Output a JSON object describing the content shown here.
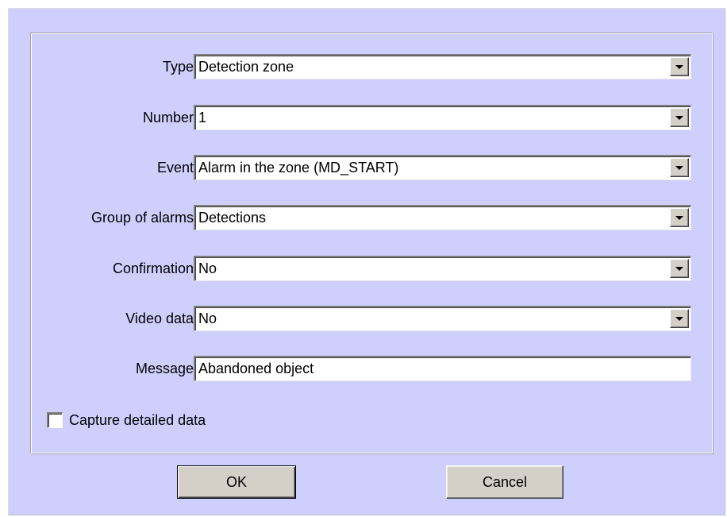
{
  "form": {
    "fields": [
      {
        "label": "Type",
        "value": "Detection zone",
        "kind": "dropdown"
      },
      {
        "label": "Number",
        "value": "1",
        "kind": "dropdown"
      },
      {
        "label": "Event",
        "value": "Alarm in the zone (MD_START)",
        "kind": "dropdown"
      },
      {
        "label": "Group of alarms",
        "value": "Detections",
        "kind": "dropdown"
      },
      {
        "label": "Confirmation",
        "value": "No",
        "kind": "dropdown"
      },
      {
        "label": "Video data",
        "value": "No",
        "kind": "dropdown"
      },
      {
        "label": "Message",
        "value": "Abandoned object",
        "kind": "text"
      }
    ],
    "capture_checkbox": {
      "label": "Capture detailed data",
      "checked": false
    }
  },
  "buttons": {
    "ok_label": "OK",
    "cancel_label": "Cancel"
  },
  "colors": {
    "dialog_background": "#cfcffd",
    "control_face": "#d4d0c8",
    "field_background": "#ffffff"
  },
  "icons": {
    "dropdown": "chevron-down-icon"
  }
}
